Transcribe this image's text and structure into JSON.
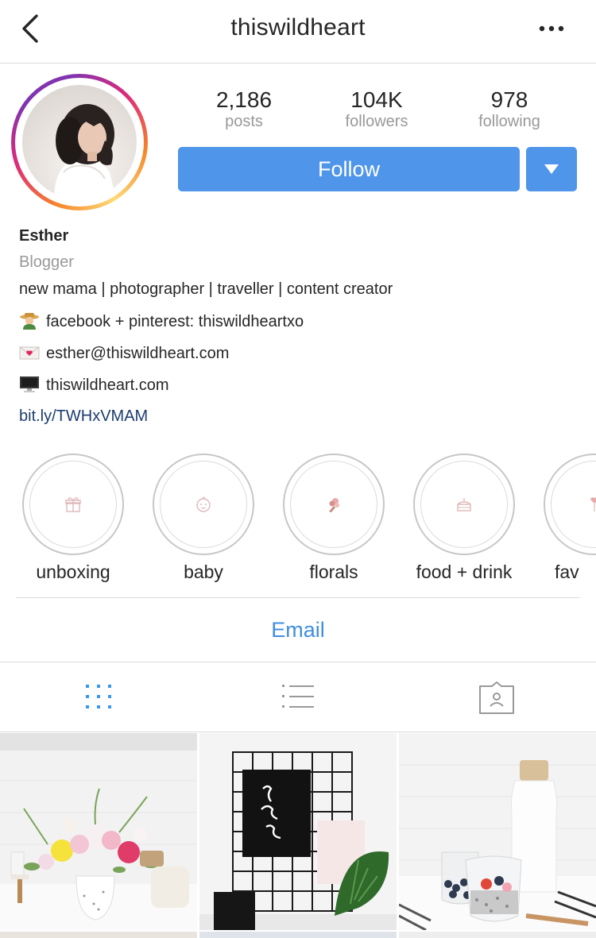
{
  "header": {
    "username": "thiswildheart"
  },
  "stats": [
    {
      "value": "2,186",
      "label": "posts"
    },
    {
      "value": "104K",
      "label": "followers"
    },
    {
      "value": "978",
      "label": "following"
    }
  ],
  "actions": {
    "follow_label": "Follow",
    "email_label": "Email"
  },
  "bio": {
    "name": "Esther",
    "category": "Blogger",
    "tagline": "new mama | photographer | traveller | content creator",
    "social": "facebook + pinterest: thiswildheartxo",
    "email": "esther@thiswildheart.com",
    "website": "thiswildheart.com",
    "link": "bit.ly/TWHxVMAM"
  },
  "highlights": [
    {
      "label": "unboxing",
      "icon": "gift-icon"
    },
    {
      "label": "baby",
      "icon": "baby-face-icon"
    },
    {
      "label": "florals",
      "icon": "bouquet-icon"
    },
    {
      "label": "food + drink",
      "icon": "cake-icon"
    },
    {
      "label": "fav",
      "icon": "heart-icon"
    }
  ],
  "tabs": [
    {
      "name": "grid-view-icon",
      "active": true
    },
    {
      "name": "list-view-icon",
      "active": false
    },
    {
      "name": "tagged-icon",
      "active": false
    }
  ],
  "colors": {
    "accent": "#4f95ea",
    "link": "#3f8ee0",
    "bio_link": "#1c3d70"
  }
}
